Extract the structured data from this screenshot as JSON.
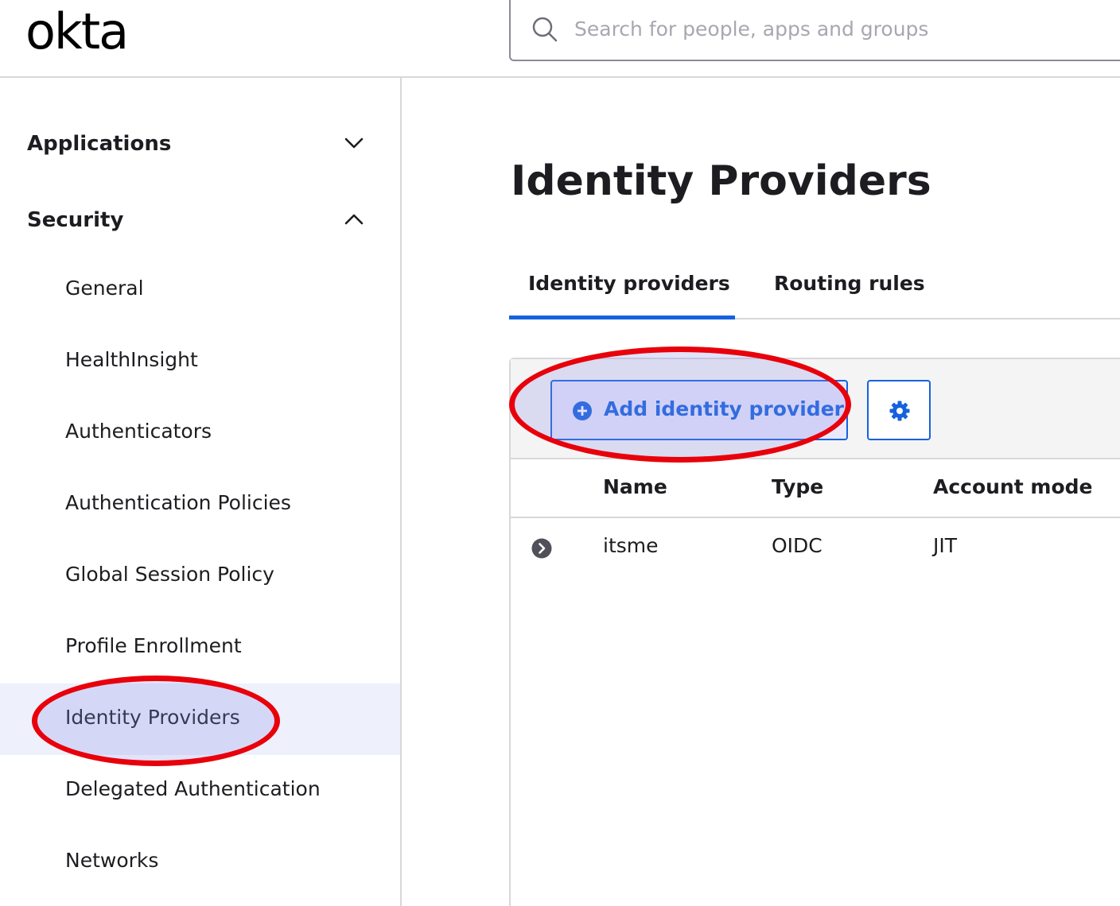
{
  "header": {
    "logo_text": "okta",
    "search_placeholder": "Search for people, apps and groups"
  },
  "sidebar": {
    "sections": [
      {
        "label": "Applications",
        "expanded": false
      },
      {
        "label": "Security",
        "expanded": true
      }
    ],
    "security_items": [
      {
        "label": "General"
      },
      {
        "label": "HealthInsight"
      },
      {
        "label": "Authenticators"
      },
      {
        "label": "Authentication Policies"
      },
      {
        "label": "Global Session Policy"
      },
      {
        "label": "Profile Enrollment"
      },
      {
        "label": "Identity Providers",
        "active": true
      },
      {
        "label": "Delegated Authentication"
      },
      {
        "label": "Networks"
      }
    ]
  },
  "main": {
    "title": "Identity Providers",
    "tabs": [
      {
        "label": "Identity providers",
        "active": true
      },
      {
        "label": "Routing rules",
        "active": false
      }
    ],
    "toolbar": {
      "add_label": "Add identity provider"
    },
    "table": {
      "columns": [
        "Name",
        "Type",
        "Account mode"
      ],
      "rows": [
        {
          "name": "itsme",
          "type": "OIDC",
          "account_mode": "JIT"
        }
      ]
    }
  },
  "colors": {
    "accent": "#1662dd",
    "active_nav_bg": "#eef0fc",
    "annotation_red": "#e8000b"
  }
}
